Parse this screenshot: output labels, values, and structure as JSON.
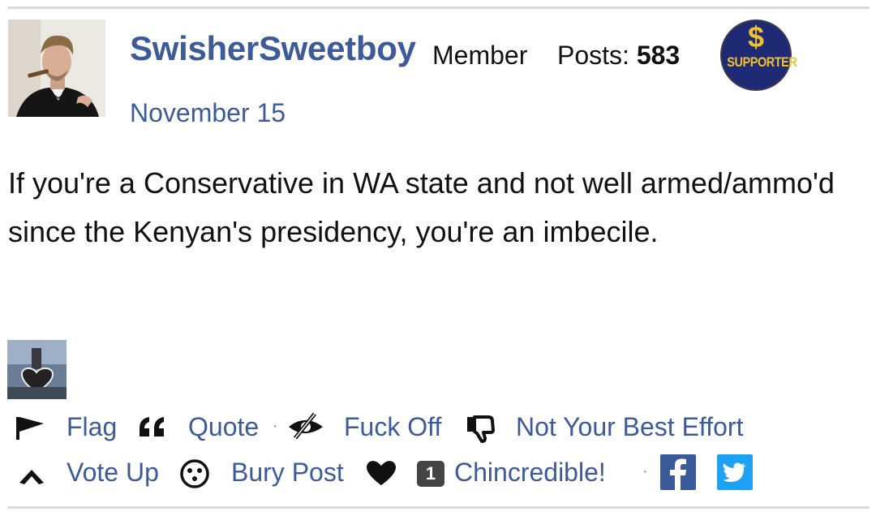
{
  "post": {
    "username": "SwisherSweetboy",
    "role": "Member",
    "posts_label": "Posts:",
    "posts_count": "583",
    "badge": {
      "symbol": "$",
      "text": "SUPPORTER"
    },
    "date": "November 15",
    "body": "If you're a Conservative in WA state and not well armed/ammo'd since the Kenyan's presidency, you're an imbecile."
  },
  "actions": {
    "flag": "Flag",
    "quote": "Quote",
    "fuck_off": "Fuck Off",
    "not_best": "Not Your Best Effort",
    "vote_up": "Vote Up",
    "bury": "Bury Post",
    "chincredible_count": "1",
    "chincredible": "Chincredible!"
  },
  "colors": {
    "link": "#3d5a99",
    "badge_bg": "#1e2a73",
    "badge_text": "#f2c12e",
    "facebook": "#3b5a9a",
    "twitter": "#1da1f2"
  },
  "icons": [
    "flag-icon",
    "quote-icon",
    "eye-slash-icon",
    "thumbs-down-icon",
    "chevron-up-icon",
    "smiley-icon",
    "heart-icon",
    "facebook-icon",
    "twitter-icon"
  ]
}
